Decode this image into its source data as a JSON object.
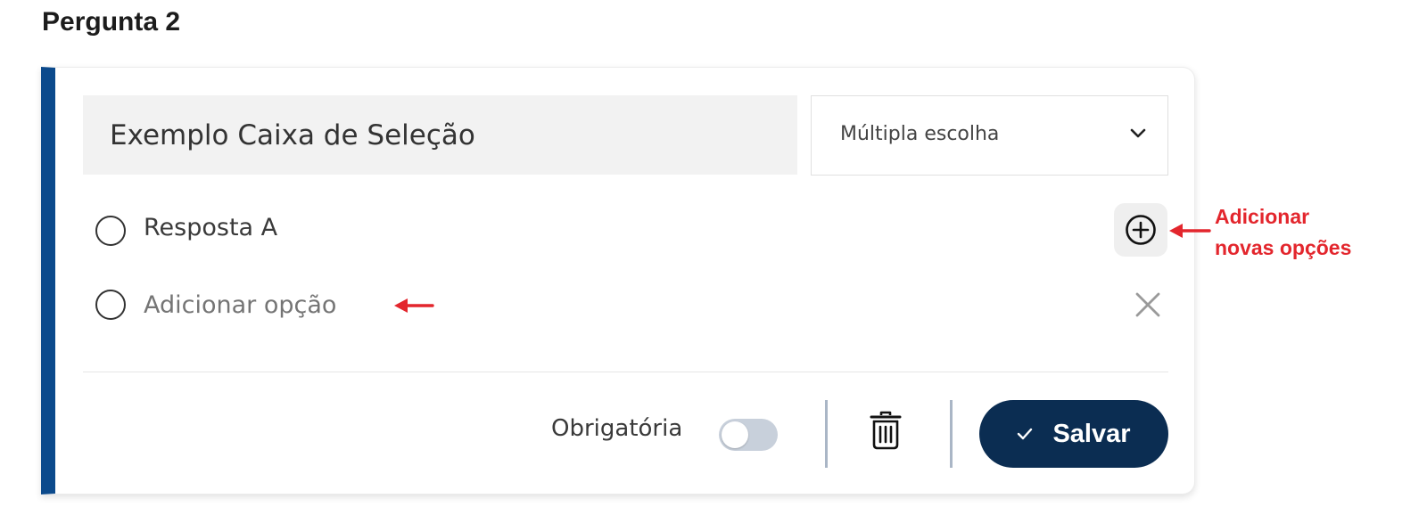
{
  "question_title": "Pergunta 2",
  "question_input_value": "Exemplo Caixa de Seleção",
  "question_type": "Múltipla escolha",
  "options": [
    {
      "label": "Resposta A"
    }
  ],
  "add_option_placeholder": "Adicionar opção",
  "required_label": "Obrigatória",
  "required_on": false,
  "save_label": "Salvar",
  "annotation": {
    "line1": "Adicionar",
    "line2": "novas opções"
  },
  "colors": {
    "accent": "#0c4a8c",
    "button": "#0b2d52",
    "annotation": "#e3262d"
  }
}
